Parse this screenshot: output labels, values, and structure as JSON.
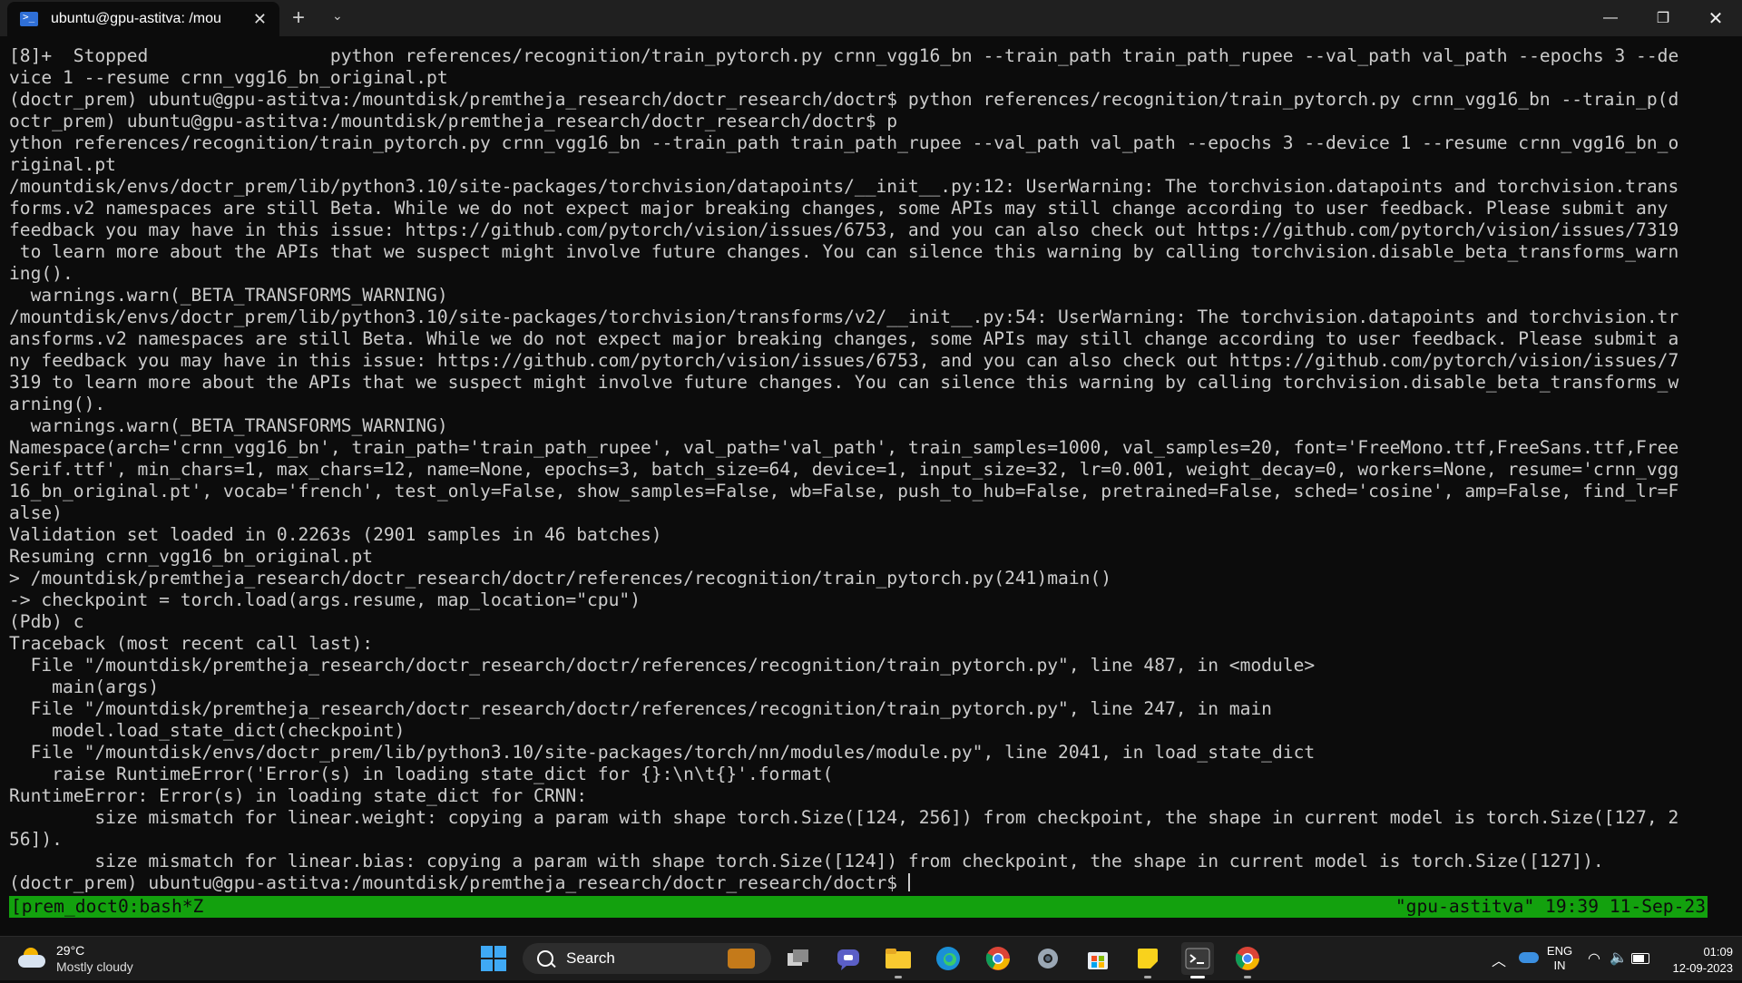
{
  "window": {
    "tab_title": "ubuntu@gpu-astitva: /mou",
    "close_tab_glyph": "✕",
    "new_tab_glyph": "+",
    "dropdown_glyph": "⌄",
    "minimize_glyph": "—",
    "maximize_glyph": "❐",
    "close_glyph": "✕",
    "icons": [
      "powershell-icon",
      "close-icon",
      "plus-icon",
      "chevron-down-icon",
      "minimize-icon",
      "maximize-icon",
      "close-icon"
    ]
  },
  "terminal": {
    "lines": [
      "[8]+  Stopped                 python references/recognition/train_pytorch.py crnn_vgg16_bn --train_path train_path_rupee --val_path val_path --epochs 3 --de",
      "vice 1 --resume crnn_vgg16_bn_original.pt",
      "(doctr_prem) ubuntu@gpu-astitva:/mountdisk/premtheja_research/doctr_research/doctr$ python references/recognition/train_pytorch.py crnn_vgg16_bn --train_p(d",
      "octr_prem) ubuntu@gpu-astitva:/mountdisk/premtheja_research/doctr_research/doctr$ p",
      "ython references/recognition/train_pytorch.py crnn_vgg16_bn --train_path train_path_rupee --val_path val_path --epochs 3 --device 1 --resume crnn_vgg16_bn_o",
      "riginal.pt",
      "/mountdisk/envs/doctr_prem/lib/python3.10/site-packages/torchvision/datapoints/__init__.py:12: UserWarning: The torchvision.datapoints and torchvision.trans",
      "forms.v2 namespaces are still Beta. While we do not expect major breaking changes, some APIs may still change according to user feedback. Please submit any",
      "feedback you may have in this issue: https://github.com/pytorch/vision/issues/6753, and you can also check out https://github.com/pytorch/vision/issues/7319",
      " to learn more about the APIs that we suspect might involve future changes. You can silence this warning by calling torchvision.disable_beta_transforms_warn",
      "ing().",
      "  warnings.warn(_BETA_TRANSFORMS_WARNING)",
      "/mountdisk/envs/doctr_prem/lib/python3.10/site-packages/torchvision/transforms/v2/__init__.py:54: UserWarning: The torchvision.datapoints and torchvision.tr",
      "ansforms.v2 namespaces are still Beta. While we do not expect major breaking changes, some APIs may still change according to user feedback. Please submit a",
      "ny feedback you may have in this issue: https://github.com/pytorch/vision/issues/6753, and you can also check out https://github.com/pytorch/vision/issues/7",
      "319 to learn more about the APIs that we suspect might involve future changes. You can silence this warning by calling torchvision.disable_beta_transforms_w",
      "arning().",
      "  warnings.warn(_BETA_TRANSFORMS_WARNING)",
      "Namespace(arch='crnn_vgg16_bn', train_path='train_path_rupee', val_path='val_path', train_samples=1000, val_samples=20, font='FreeMono.ttf,FreeSans.ttf,Free",
      "Serif.ttf', min_chars=1, max_chars=12, name=None, epochs=3, batch_size=64, device=1, input_size=32, lr=0.001, weight_decay=0, workers=None, resume='crnn_vgg",
      "16_bn_original.pt', vocab='french', test_only=False, show_samples=False, wb=False, push_to_hub=False, pretrained=False, sched='cosine', amp=False, find_lr=F",
      "alse)",
      "Validation set loaded in 0.2263s (2901 samples in 46 batches)",
      "Resuming crnn_vgg16_bn_original.pt",
      "> /mountdisk/premtheja_research/doctr_research/doctr/references/recognition/train_pytorch.py(241)main()",
      "-> checkpoint = torch.load(args.resume, map_location=\"cpu\")",
      "(Pdb) c",
      "Traceback (most recent call last):",
      "  File \"/mountdisk/premtheja_research/doctr_research/doctr/references/recognition/train_pytorch.py\", line 487, in <module>",
      "    main(args)",
      "  File \"/mountdisk/premtheja_research/doctr_research/doctr/references/recognition/train_pytorch.py\", line 247, in main",
      "    model.load_state_dict(checkpoint)",
      "  File \"/mountdisk/envs/doctr_prem/lib/python3.10/site-packages/torch/nn/modules/module.py\", line 2041, in load_state_dict",
      "    raise RuntimeError('Error(s) in loading state_dict for {}:\\n\\t{}'.format(",
      "RuntimeError: Error(s) in loading state_dict for CRNN:",
      "        size mismatch for linear.weight: copying a param with shape torch.Size([124, 256]) from checkpoint, the shape in current model is torch.Size([127, 2",
      "56]).",
      "        size mismatch for linear.bias: copying a param with shape torch.Size([124]) from checkpoint, the shape in current model is torch.Size([127]).",
      "(doctr_prem) ubuntu@gpu-astitva:/mountdisk/premtheja_research/doctr_research/doctr$ "
    ]
  },
  "tmux_status": {
    "left": "[prem_doct0:bash*Z",
    "right": "\"gpu-astitva\" 19:39 11-Sep-23"
  },
  "taskbar": {
    "weather_temp": "29°C",
    "weather_desc": "Mostly cloudy",
    "search_label": "Search",
    "lang_line1": "ENG",
    "lang_line2": "IN",
    "time": "01:09",
    "date": "12-09-2023",
    "tray_chevron": "︿",
    "wifi_glyph": "◠",
    "volume_glyph": "🔈",
    "colors": {
      "accent_green": "#13a10e",
      "taskbar_bg": "#1c1c1c"
    }
  }
}
